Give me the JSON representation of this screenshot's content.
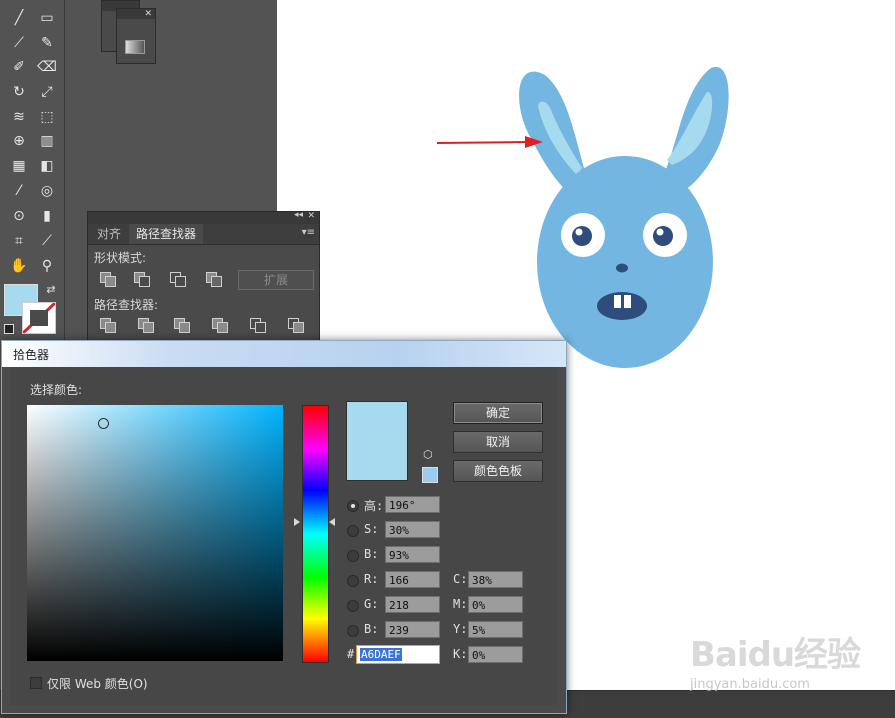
{
  "colors": {
    "accent_fill": "#A6DAEF",
    "rabbit_body": "#73B6E2",
    "rabbit_ear_inner": "#A6DAEF",
    "arrow": "#E02020"
  },
  "toolbar": {
    "icons": [
      "line-icon",
      "rectangle-icon",
      "brush-icon",
      "pencil-icon",
      "blob-brush-icon",
      "eraser-icon",
      "rotate-icon",
      "scale-icon",
      "warp-icon",
      "free-transform-icon",
      "shape-builder-icon",
      "graph-icon",
      "mesh-icon",
      "gradient-icon",
      "eyedropper-icon",
      "blend-icon",
      "symbol-sprayer-icon",
      "column-graph-icon",
      "artboard-icon",
      "slice-icon",
      "hand-icon",
      "zoom-icon"
    ]
  },
  "pathfinder_panel": {
    "tabs": [
      "对齐",
      "路径查找器"
    ],
    "shape_modes_label": "形状模式:",
    "expand_label": "扩展",
    "pathfinders_label": "路径查找器:"
  },
  "color_picker": {
    "title": "拾色器",
    "select_color_label": "选择颜色:",
    "buttons": {
      "ok": "确定",
      "cancel": "取消",
      "swatches": "颜色色板"
    },
    "fields": [
      {
        "key": "高:",
        "value": "196°",
        "radio": true,
        "selected": true
      },
      {
        "key": "S:",
        "value": "30%",
        "radio": true,
        "selected": false
      },
      {
        "key": "B:",
        "value": "93%",
        "radio": true,
        "selected": false
      },
      {
        "key": "R:",
        "value": "166",
        "radio": true,
        "selected": false
      },
      {
        "key": "G:",
        "value": "218",
        "radio": true,
        "selected": false
      },
      {
        "key": "B:",
        "value": "239",
        "radio": true,
        "selected": false
      }
    ],
    "cmyk": [
      {
        "key": "C:",
        "value": "38%"
      },
      {
        "key": "M:",
        "value": "0%"
      },
      {
        "key": "Y:",
        "value": "5%"
      },
      {
        "key": "K:",
        "value": "0%"
      }
    ],
    "hex_label": "#",
    "hex_value": "A6DAEF",
    "web_only_label": "仅限 Web 颜色(O)"
  },
  "watermark": {
    "brand": "Baidu经验",
    "url": "jingyan.baidu.com"
  }
}
